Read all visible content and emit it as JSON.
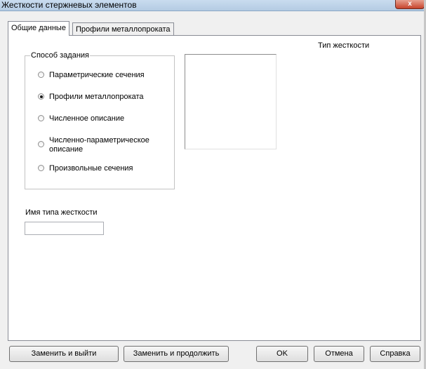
{
  "window": {
    "title": "Жесткости стержневых элементов",
    "close_label": "x"
  },
  "tabs": [
    {
      "label": "Общие данные",
      "active": true
    },
    {
      "label": "Профили металлопроката",
      "active": false
    }
  ],
  "method_group": {
    "legend": "Способ задания",
    "options": [
      {
        "label": "Параметрические сечения",
        "checked": false
      },
      {
        "label": "Профили металлопроката",
        "checked": true
      },
      {
        "label": "Численное описание",
        "checked": false
      },
      {
        "label": "Численно-параметрическое описание",
        "checked": false
      },
      {
        "label": "Произвольные сечения",
        "checked": false
      }
    ]
  },
  "stiffness_type": {
    "label": "Тип жесткости"
  },
  "stiffness_name": {
    "label": "Имя типа жесткости",
    "value": ""
  },
  "buttons": {
    "replace_exit": "Заменить и выйти",
    "replace_continue": "Заменить и продолжить",
    "ok": "OK",
    "cancel": "Отмена",
    "help": "Справка"
  }
}
